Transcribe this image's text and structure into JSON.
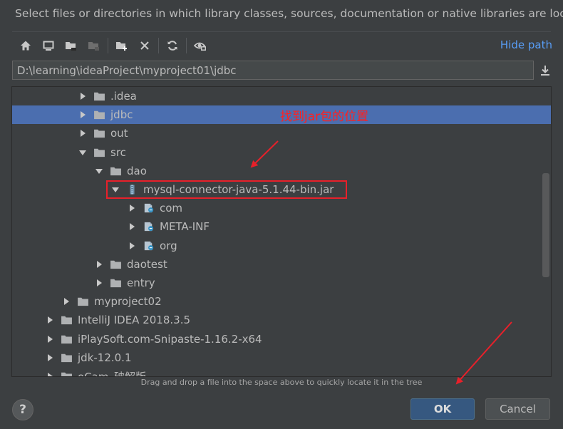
{
  "dialog": {
    "title": "Select files or directories in which library classes, sources, documentation or native libraries are located"
  },
  "toolbar": {
    "buttons": [
      "home-icon",
      "desktop-icon",
      "project-folder-icon",
      "module-folder-icon",
      "new-folder-icon",
      "delete-icon",
      "refresh-icon",
      "show-hidden-icon"
    ],
    "hide_path_label": "Hide path"
  },
  "path": {
    "value": "D:\\learning\\ideaProject\\myproject01\\jdbc"
  },
  "tree": {
    "items": [
      {
        "label": ".idea",
        "icon": "folder-icon",
        "expanded": false,
        "selected": false,
        "level": 4
      },
      {
        "label": "jdbc",
        "icon": "folder-icon",
        "expanded": false,
        "selected": true,
        "level": 4
      },
      {
        "label": "out",
        "icon": "folder-icon",
        "expanded": false,
        "selected": false,
        "level": 4
      },
      {
        "label": "src",
        "icon": "folder-icon",
        "expanded": true,
        "selected": false,
        "level": 4
      },
      {
        "label": "dao",
        "icon": "folder-icon",
        "expanded": true,
        "selected": false,
        "level": 5
      },
      {
        "label": "mysql-connector-java-5.1.44-bin.jar",
        "icon": "jar-icon",
        "expanded": true,
        "selected": false,
        "level": 6
      },
      {
        "label": "com",
        "icon": "package-icon",
        "expanded": false,
        "selected": false,
        "level": 7
      },
      {
        "label": "META-INF",
        "icon": "package-icon",
        "expanded": false,
        "selected": false,
        "level": 7
      },
      {
        "label": "org",
        "icon": "package-icon",
        "expanded": false,
        "selected": false,
        "level": 7
      },
      {
        "label": "daotest",
        "icon": "folder-icon",
        "expanded": false,
        "selected": false,
        "level": 5
      },
      {
        "label": "entry",
        "icon": "folder-icon",
        "expanded": false,
        "selected": false,
        "level": 5
      },
      {
        "label": "myproject02",
        "icon": "folder-icon",
        "expanded": false,
        "selected": false,
        "level": 3
      },
      {
        "label": "IntelliJ IDEA 2018.3.5",
        "icon": "folder-icon",
        "expanded": false,
        "selected": false,
        "level": 2
      },
      {
        "label": "iPlaySoft.com-Snipaste-1.16.2-x64",
        "icon": "folder-icon",
        "expanded": false,
        "selected": false,
        "level": 2
      },
      {
        "label": "jdk-12.0.1",
        "icon": "folder-icon",
        "expanded": false,
        "selected": false,
        "level": 2
      },
      {
        "label": "oCam_破解版",
        "icon": "folder-icon",
        "expanded": false,
        "selected": false,
        "level": 2
      }
    ]
  },
  "annotation": {
    "text": "找到jar包的位置"
  },
  "hint": "Drag and drop a file into the space above to quickly locate it in the tree",
  "buttons": {
    "help": "?",
    "ok": "OK",
    "cancel": "Cancel"
  },
  "colors": {
    "background": "#3c3f41",
    "selection": "#4b6eaf",
    "link": "#589df6",
    "annotation": "#ff2020",
    "ok_button": "#365880"
  }
}
